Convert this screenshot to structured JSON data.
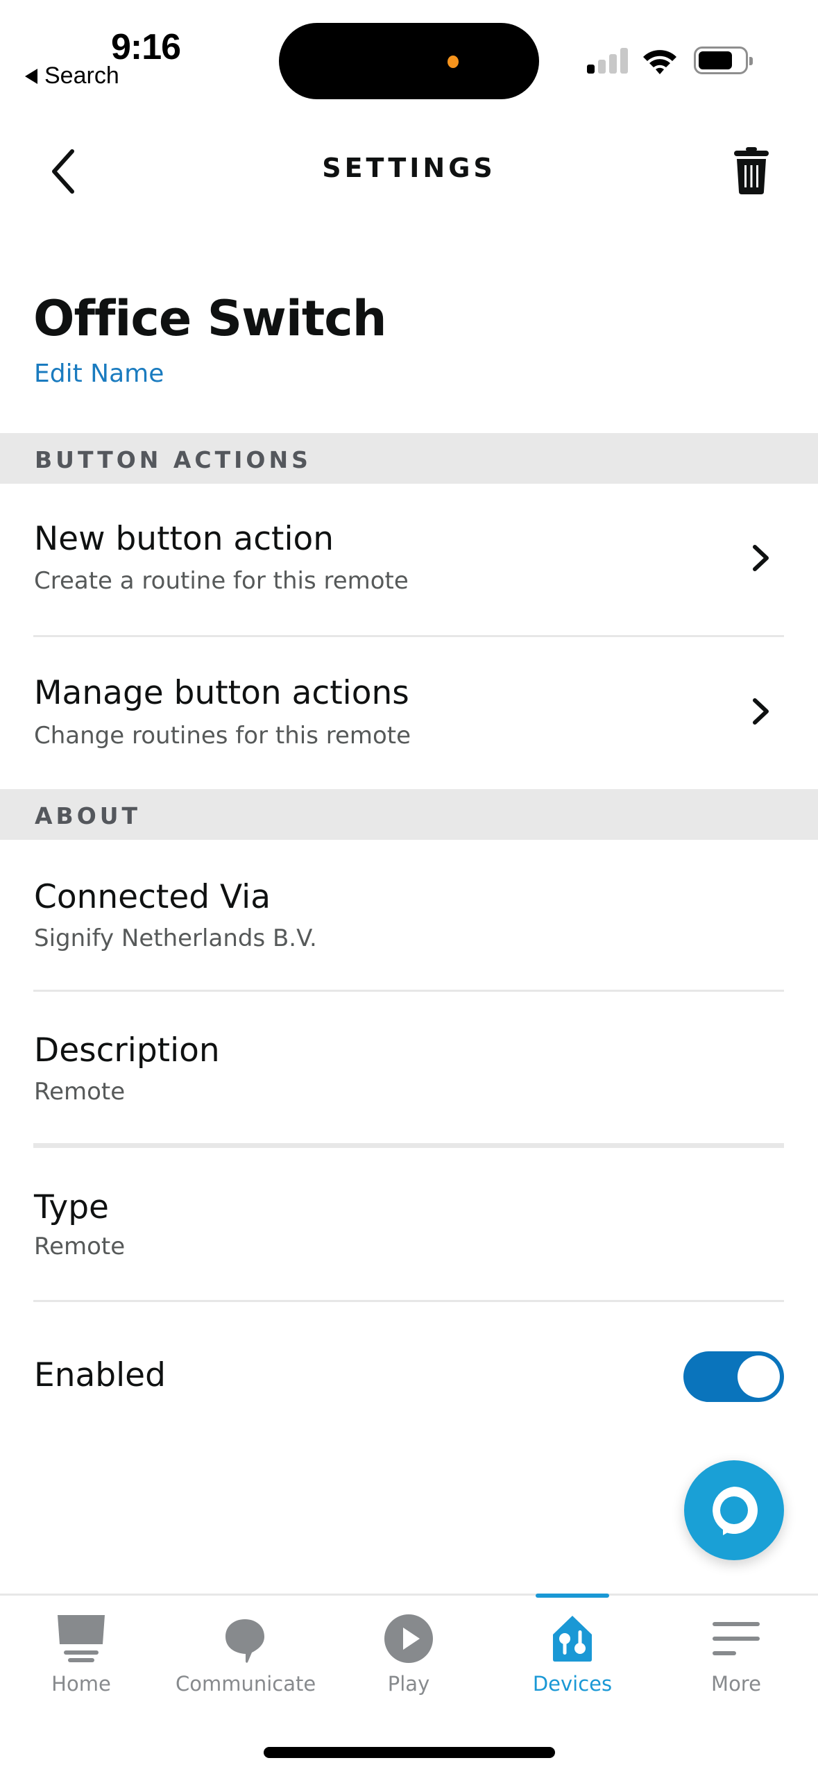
{
  "status_bar": {
    "time": "9:16",
    "back_app_label": "Search",
    "signal_bars_active": 1,
    "signal_bars_total": 4,
    "battery_level_percent": 75
  },
  "header": {
    "title": "SETTINGS",
    "back_icon": "chevron-left-icon",
    "delete_icon": "trash-icon"
  },
  "device": {
    "name": "Office Switch",
    "edit_name_label": "Edit Name"
  },
  "sections": {
    "button_actions": {
      "header": "BUTTON ACTIONS",
      "items": [
        {
          "title": "New button action",
          "subtitle": "Create a routine for this remote"
        },
        {
          "title": "Manage button actions",
          "subtitle": "Change routines for this remote"
        }
      ]
    },
    "about": {
      "header": "ABOUT",
      "items": [
        {
          "title": "Connected Via",
          "subtitle": "Signify Netherlands B.V."
        },
        {
          "title": "Description",
          "subtitle": "Remote"
        },
        {
          "title": "Type",
          "subtitle": "Remote"
        }
      ],
      "enabled": {
        "label": "Enabled",
        "value": true
      }
    }
  },
  "alexa_button": {
    "icon": "alexa-icon"
  },
  "bottom_nav": {
    "active": "Devices",
    "items": [
      {
        "label": "Home",
        "icon": "home-icon"
      },
      {
        "label": "Communicate",
        "icon": "chat-bubble-icon"
      },
      {
        "label": "Play",
        "icon": "play-icon"
      },
      {
        "label": "Devices",
        "icon": "devices-house-icon"
      },
      {
        "label": "More",
        "icon": "menu-icon"
      }
    ]
  },
  "colors": {
    "accent": "#1A98D5",
    "link": "#1A7BBF",
    "toggle_on": "#0A74BC",
    "section_band": "#E8E8E8",
    "inactive_nav": "#878A8D"
  }
}
